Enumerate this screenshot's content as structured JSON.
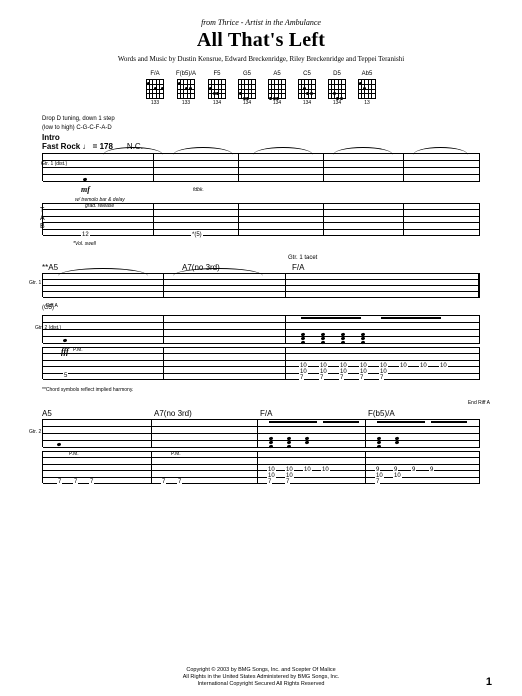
{
  "header": {
    "from_line": "from Thrice - Artist in the Ambulance",
    "title": "All That's Left",
    "credits": "Words and Music by Dustin Kensrue, Edward Breckenridge, Riley Breckenridge and Teppei Teranishi"
  },
  "chords": [
    {
      "name": "F/A",
      "fingering": "133"
    },
    {
      "name": "F(b5)/A",
      "fingering": "133"
    },
    {
      "name": "F5",
      "fingering": "134"
    },
    {
      "name": "G5",
      "fingering": "134"
    },
    {
      "name": "A5",
      "fingering": "134"
    },
    {
      "name": "C5",
      "fingering": "134"
    },
    {
      "name": "D5",
      "fingering": "134"
    },
    {
      "name": "Ab5",
      "fingering": "13"
    }
  ],
  "tuning_note_1": "Drop D tuning, down 1 step",
  "tuning_note_2": "(low to high) C-G-C-F-A-D",
  "section_intro": "Intro",
  "tempo": "Fast Rock ♩ = 178",
  "nc_chord": "N.C.",
  "gtr1_label": "Gtr. 1 (dist.)",
  "dynamics": {
    "mf": "mf",
    "fff": "fff"
  },
  "technique": {
    "tremolo": "w/ tremolo bar & delay",
    "grad_release": "grad. release",
    "fdbk": "fdbk.",
    "vol_swell": "*Vol. swell"
  },
  "tab_values": {
    "intro_low": "12",
    "intro_harm": "*(5)"
  },
  "sys2": {
    "chord_a5": "**A5",
    "chord_a7": "A7(no 3rd)",
    "gtr1_tacet": "Gtr. 1 tacet",
    "chord_fa": "F/A",
    "gtr2_label": "Gtr. 2 (dist.)",
    "g5_paren": "(G5)",
    "footnote": "**Chord symbols reflect implied harmony.",
    "pm": "P.M.",
    "riff_a": "Riff A"
  },
  "sys3": {
    "chord_a5": "A5",
    "chord_a7": "A7(no 3rd)",
    "chord_fa": "F/A",
    "chord_fb5a": "F(b5)/A",
    "end_riff": "End Riff A",
    "pm": "P.M."
  },
  "copyright": {
    "line1": "Copyright © 2003 by BMG Songs, Inc. and Scepter Of Malice",
    "line2": "All Rights in the United States Administered by BMG Songs, Inc.",
    "line3": "International Copyright Secured   All Rights Reserved"
  },
  "page_number": "1"
}
